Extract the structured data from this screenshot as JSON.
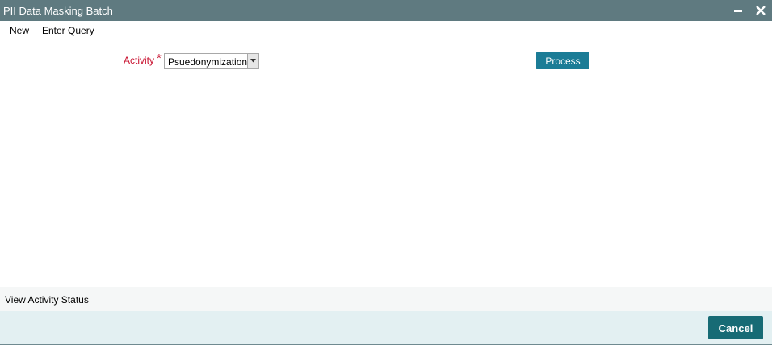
{
  "window": {
    "title": "PII Data Masking Batch"
  },
  "menu": {
    "items": [
      "New",
      "Enter Query"
    ]
  },
  "form": {
    "activity_label": "Activity",
    "required_mark": "*",
    "activity_value": "Psuedonymization",
    "process_label": "Process"
  },
  "status": {
    "view_activity_status": "View Activity Status"
  },
  "footer": {
    "cancel_label": "Cancel"
  },
  "colors": {
    "titlebar": "#5f7a80",
    "process_button": "#1b7c96",
    "cancel_button": "#176b75",
    "required": "#c8102e"
  }
}
